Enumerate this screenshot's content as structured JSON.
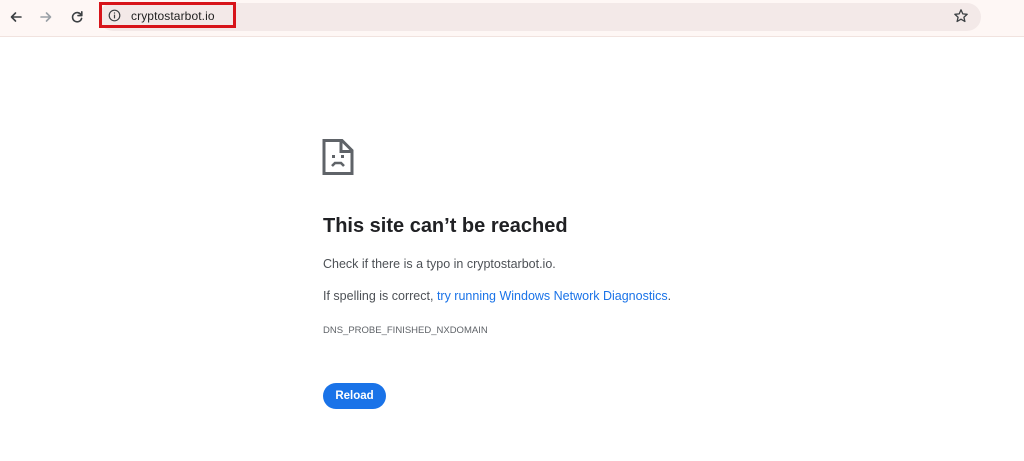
{
  "toolbar": {
    "url": "cryptostarbot.io",
    "back_icon": "arrow-left-icon",
    "forward_icon": "arrow-right-icon",
    "reload_icon": "reload-icon",
    "site_info_icon": "info-icon",
    "bookmark_icon": "star-icon",
    "highlight_color": "#d7141a"
  },
  "error_page": {
    "icon": "sad-document-icon",
    "title": "This site can’t be reached",
    "typo_hint": "Check if there is a typo in cryptostarbot.io.",
    "spelling_prefix": "If spelling is correct, ",
    "diagnostics_link": "try running Windows Network Diagnostics",
    "spelling_suffix": ".",
    "error_code": "DNS_PROBE_FINISHED_NXDOMAIN",
    "reload_label": "Reload",
    "accent_color": "#1a73e8"
  }
}
